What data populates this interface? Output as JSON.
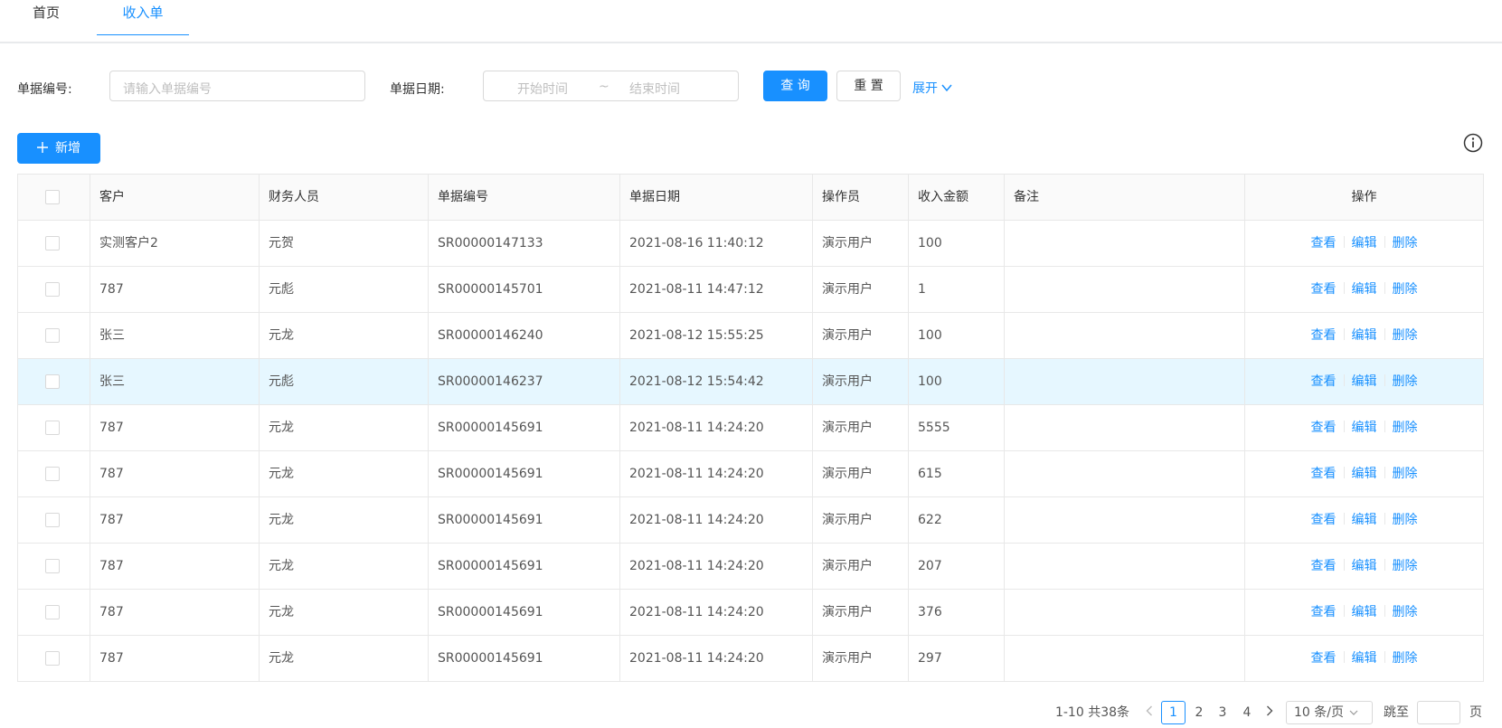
{
  "tabs": [
    {
      "label": "首页",
      "active": false
    },
    {
      "label": "收入单",
      "active": true
    }
  ],
  "search": {
    "doc_no_label": "单据编号:",
    "doc_no_placeholder": "请输入单据编号",
    "date_label": "单据日期:",
    "start_placeholder": "开始时间",
    "range_sep": "~",
    "end_placeholder": "结束时间",
    "query_label": "查 询",
    "reset_label": "重 置",
    "expand_label": "展开"
  },
  "toolbar": {
    "add_label": "新增"
  },
  "table": {
    "columns": [
      "客户",
      "财务人员",
      "单据编号",
      "单据日期",
      "操作员",
      "收入金额",
      "备注",
      "操作"
    ],
    "actions": [
      "查看",
      "编辑",
      "删除"
    ],
    "rows": [
      {
        "customer": "实测客户2",
        "finance": "元贺",
        "doc_no": "SR00000147133",
        "date": "2021-08-16 11:40:12",
        "operator": "演示用户",
        "amount": "100",
        "remark": ""
      },
      {
        "customer": "787",
        "finance": "元彪",
        "doc_no": "SR00000145701",
        "date": "2021-08-11 14:47:12",
        "operator": "演示用户",
        "amount": "1",
        "remark": ""
      },
      {
        "customer": "张三",
        "finance": "元龙",
        "doc_no": "SR00000146240",
        "date": "2021-08-12 15:55:25",
        "operator": "演示用户",
        "amount": "100",
        "remark": ""
      },
      {
        "customer": "张三",
        "finance": "元彪",
        "doc_no": "SR00000146237",
        "date": "2021-08-12 15:54:42",
        "operator": "演示用户",
        "amount": "100",
        "remark": ""
      },
      {
        "customer": "787",
        "finance": "元龙",
        "doc_no": "SR00000145691",
        "date": "2021-08-11 14:24:20",
        "operator": "演示用户",
        "amount": "5555",
        "remark": ""
      },
      {
        "customer": "787",
        "finance": "元龙",
        "doc_no": "SR00000145691",
        "date": "2021-08-11 14:24:20",
        "operator": "演示用户",
        "amount": "615",
        "remark": ""
      },
      {
        "customer": "787",
        "finance": "元龙",
        "doc_no": "SR00000145691",
        "date": "2021-08-11 14:24:20",
        "operator": "演示用户",
        "amount": "622",
        "remark": ""
      },
      {
        "customer": "787",
        "finance": "元龙",
        "doc_no": "SR00000145691",
        "date": "2021-08-11 14:24:20",
        "operator": "演示用户",
        "amount": "207",
        "remark": ""
      },
      {
        "customer": "787",
        "finance": "元龙",
        "doc_no": "SR00000145691",
        "date": "2021-08-11 14:24:20",
        "operator": "演示用户",
        "amount": "376",
        "remark": ""
      },
      {
        "customer": "787",
        "finance": "元龙",
        "doc_no": "SR00000145691",
        "date": "2021-08-11 14:24:20",
        "operator": "演示用户",
        "amount": "297",
        "remark": ""
      }
    ]
  },
  "pagination": {
    "summary": "1-10 共38条",
    "pages": [
      "1",
      "2",
      "3",
      "4"
    ],
    "current": "1",
    "page_size": "10 条/页",
    "jump_label": "跳至",
    "jump_suffix": "页"
  },
  "colors": {
    "primary": "#1890ff",
    "border": "#e8e8e8",
    "hover_row": "#e6f7ff"
  },
  "icons": {
    "add": "plus-icon",
    "expand": "chevron-down-icon",
    "info": "info-circle-icon",
    "prev": "chevron-left-icon",
    "next": "chevron-right-icon"
  }
}
